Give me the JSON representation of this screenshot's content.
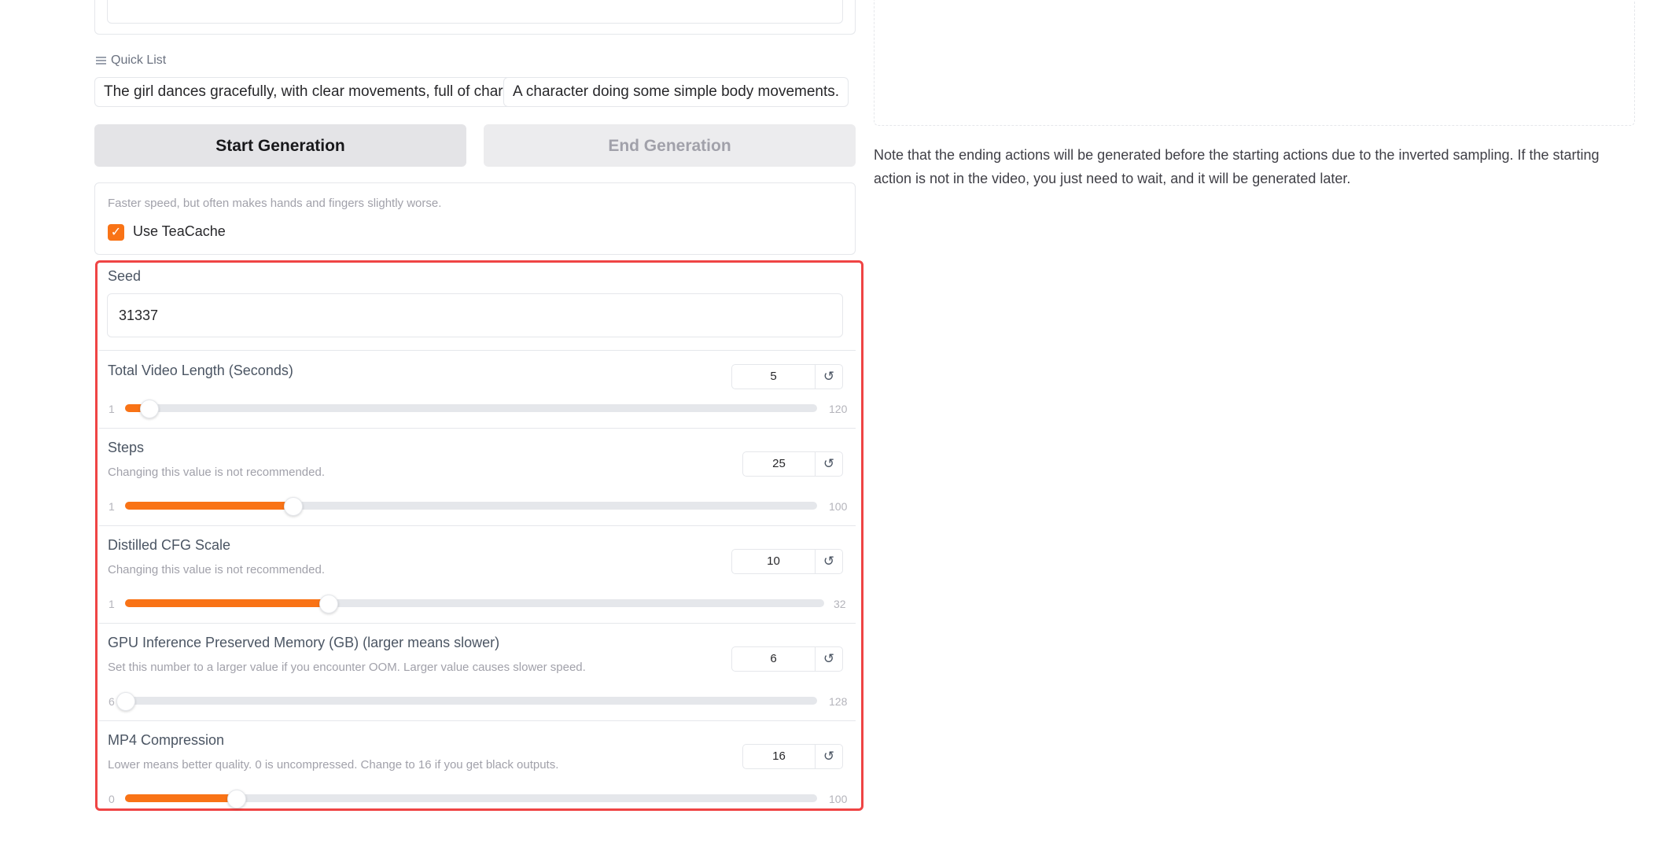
{
  "quick_list": {
    "label": "Quick List",
    "items": [
      "The girl dances gracefully, with clear movements, full of charm.",
      "A character doing some simple body movements."
    ]
  },
  "buttons": {
    "start": "Start Generation",
    "end": "End Generation"
  },
  "teacache": {
    "info": "Faster speed, but often makes hands and fingers slightly worse.",
    "label": "Use TeaCache",
    "checked": true
  },
  "seed": {
    "label": "Seed",
    "value": "31337"
  },
  "sliders": [
    {
      "label": "Total Video Length (Seconds)",
      "info": "",
      "value": 5,
      "min": 1,
      "max": 120,
      "value_text": "5",
      "min_text": "1",
      "max_text": "120"
    },
    {
      "label": "Steps",
      "info": "Changing this value is not recommended.",
      "value": 25,
      "min": 1,
      "max": 100,
      "value_text": "25",
      "min_text": "1",
      "max_text": "100"
    },
    {
      "label": "Distilled CFG Scale",
      "info": "Changing this value is not recommended.",
      "value": 10,
      "min": 1,
      "max": 32,
      "value_text": "10",
      "min_text": "1",
      "max_text": "32"
    },
    {
      "label": "GPU Inference Preserved Memory (GB) (larger means slower)",
      "info": "Set this number to a larger value if you encounter OOM. Larger value causes slower speed.",
      "value": 6,
      "min": 6,
      "max": 128,
      "value_text": "6",
      "min_text": "6",
      "max_text": "128"
    },
    {
      "label": "MP4 Compression",
      "info": "Lower means better quality. 0 is uncompressed. Change to 16 if you get black outputs.",
      "value": 16,
      "min": 0,
      "max": 100,
      "value_text": "16",
      "min_text": "0",
      "max_text": "100"
    }
  ],
  "reset_glyph": "↺",
  "note": "Note that the ending actions will be generated before the starting actions due to the inverted sampling. If the starting action is not in the video, you just need to wait, and it will be generated later.",
  "colors": {
    "accent": "#f97316",
    "highlight_border": "#ef4444"
  }
}
